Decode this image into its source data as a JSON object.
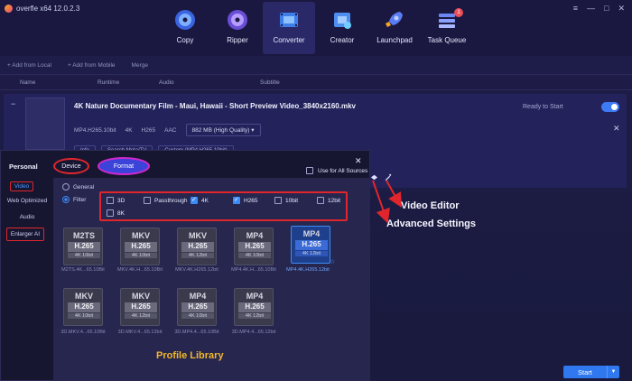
{
  "app": {
    "title": "overfle x64 12.0.2.3"
  },
  "window_controls": [
    "≡",
    "—",
    "□",
    "✕"
  ],
  "nav": [
    {
      "label": "Copy",
      "icon": "disc-copy-icon",
      "color": "#5b8ff9"
    },
    {
      "label": "Ripper",
      "icon": "disc-ripper-icon",
      "color": "#8a6cf3"
    },
    {
      "label": "Converter",
      "icon": "film-converter-icon",
      "color": "#5ab0f5"
    },
    {
      "label": "Creator",
      "icon": "film-creator-icon",
      "color": "#5fa3f5"
    },
    {
      "label": "Launchpad",
      "icon": "rocket-icon",
      "color": "#6b7bf5"
    },
    {
      "label": "Task Queue",
      "icon": "task-queue-icon",
      "color": "#7a8cf5",
      "badge": "1"
    }
  ],
  "toolbar": {
    "add_local": "+ Add from Local",
    "add_mobile": "+ Add from Mobile",
    "merge": "Merge"
  },
  "columns": {
    "name": "Name",
    "runtime": "Runtime",
    "audio": "Audio",
    "subtitle": "Subtitle"
  },
  "file": {
    "title": "4K Nature Documentary Film - Maui, Hawaii - Short Preview Video_3840x2160.mkv",
    "codec": "MP4.H265.10bit",
    "res": "4K",
    "video": "H265",
    "audio": "AAC",
    "size": "882 MB (High Quality)",
    "status": "Ready to Start",
    "btn_info": "Info",
    "btn_search": "Search Meta/TV",
    "btn_custom": "Custom (MP4.H265.10bit)"
  },
  "panel": {
    "personal": "Personal",
    "device": "Device",
    "format": "Format",
    "use_all": "Use for All Sources",
    "close": "✕",
    "sidebar": [
      "Video",
      "Web Optimized",
      "Audio",
      "Enlarger AI"
    ],
    "general": "General",
    "filter": "Filter",
    "filters": [
      {
        "label": "3D",
        "checked": false
      },
      {
        "label": "Passthrough",
        "checked": false
      },
      {
        "label": "4K",
        "checked": true
      },
      {
        "label": "H265",
        "checked": true
      },
      {
        "label": "10bit",
        "checked": false
      },
      {
        "label": "12bit",
        "checked": false
      },
      {
        "label": "8K",
        "checked": false
      }
    ],
    "cards": [
      {
        "fmt": "M2TS",
        "codec": "H.265",
        "spec": "4K 10bit",
        "caption": "M2TS.4K...65.10Bit"
      },
      {
        "fmt": "MKV",
        "codec": "H.265",
        "spec": "4K 10bit",
        "caption": "MKV.4K.H...65.10Bit"
      },
      {
        "fmt": "MKV",
        "codec": "H.265",
        "spec": "4K 12bit",
        "caption": "MKV.4K.H265.12bit"
      },
      {
        "fmt": "MP4",
        "codec": "H.265",
        "spec": "4K 10bit",
        "caption": "MP4.4K.H...65.10Bit"
      },
      {
        "fmt": "MP4",
        "codec": "H.265",
        "spec": "4K 12bit",
        "caption": "MP4.4K.H265.12bit"
      },
      {
        "fmt": "MKV",
        "codec": "H.265",
        "spec": "4K 10bit",
        "caption": "3D.MKV.4...65.10Bit"
      },
      {
        "fmt": "MKV",
        "codec": "H.265",
        "spec": "4K 12bit",
        "caption": "3D.MKV.4...65.12bit"
      },
      {
        "fmt": "MP4",
        "codec": "H.265",
        "spec": "4K 10bit",
        "caption": "3D.MP4.4...65.10Bit"
      },
      {
        "fmt": "MP4",
        "codec": "H.265",
        "spec": "4K 12bit",
        "caption": "3D.MP4.4...65.12bit"
      }
    ],
    "library_label": "Profile Library"
  },
  "annotations": {
    "video_editor": "Video Editor",
    "advanced": "Advanced Settings"
  },
  "start": {
    "label": "Start",
    "dropdown": "▼"
  },
  "colors": {
    "accent": "#3d8bf5",
    "highlight": "#e0262c",
    "library": "#f4b728"
  }
}
